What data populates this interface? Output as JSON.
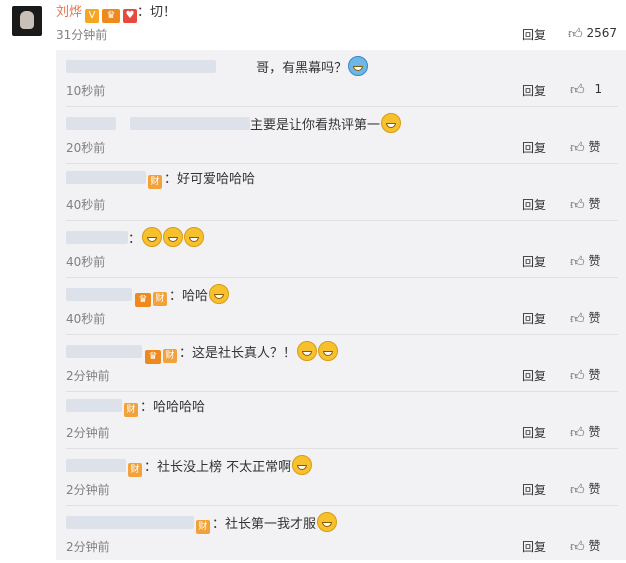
{
  "post": {
    "author": "刘烨",
    "text": "：切！",
    "time": "31分钟前",
    "reply_label": "回复",
    "like_count": "2567"
  },
  "comments": [
    {
      "text": "哥，有黑幕吗？",
      "time": "10秒前",
      "reply": "回复",
      "like": "1",
      "emojis": 1,
      "emoji_style": "blue"
    },
    {
      "text": "主要是让你看热评第一",
      "time": "20秒前",
      "reply": "回复",
      "like": "赞",
      "emojis": 1
    },
    {
      "text": "：好可爱哈哈哈",
      "time": "40秒前",
      "reply": "回复",
      "like": "赞",
      "emojis": 0
    },
    {
      "text": "：",
      "time": "40秒前",
      "reply": "回复",
      "like": "赞",
      "emojis": 3
    },
    {
      "text": "：哈哈",
      "time": "40秒前",
      "reply": "回复",
      "like": "赞",
      "emojis": 1
    },
    {
      "text": "：这是社长真人？！",
      "time": "2分钟前",
      "reply": "回复",
      "like": "赞",
      "emojis": 2
    },
    {
      "text": "：哈哈哈哈",
      "time": "2分钟前",
      "reply": "回复",
      "like": "赞",
      "emojis": 0
    },
    {
      "text": "：社长没上榜 不太正常啊",
      "time": "2分钟前",
      "reply": "回复",
      "like": "赞",
      "emojis": 1
    },
    {
      "text": "：社长第一我才服",
      "time": "2分钟前",
      "reply": "回复",
      "like": "赞",
      "emojis": 1
    }
  ],
  "badges": {
    "cai": "财"
  }
}
